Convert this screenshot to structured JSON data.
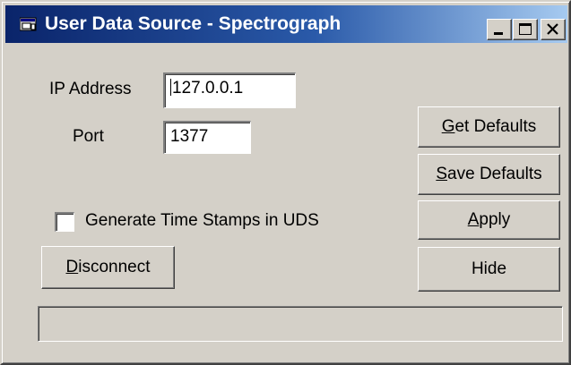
{
  "window": {
    "title": "User Data Source - Spectrograph",
    "icon": "app-window-icon",
    "controls": [
      "minimize-icon",
      "maximize-icon",
      "close-icon"
    ]
  },
  "connection": {
    "ip_label": "IP Address",
    "ip_value": "127.0.0.1",
    "port_label": "Port",
    "port_value": "1377"
  },
  "options": {
    "timestamps_label": "Generate Time Stamps in UDS",
    "timestamps_checked": false
  },
  "buttons": {
    "get_defaults": {
      "mnemonic": "G",
      "rest": "et Defaults"
    },
    "save_defaults": {
      "mnemonic": "S",
      "rest": "ave Defaults"
    },
    "apply": {
      "mnemonic": "A",
      "rest": "pply"
    },
    "hide": {
      "label": "Hide"
    },
    "disconnect": {
      "mnemonic": "D",
      "rest": "isconnect"
    }
  },
  "status": {
    "text": ""
  },
  "colors": {
    "face": "#d4d0c8",
    "title_start": "#0a246a",
    "title_end": "#a6caf0"
  }
}
